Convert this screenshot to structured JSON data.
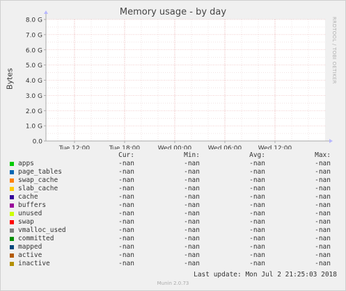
{
  "chart_data": {
    "type": "area",
    "title": "Memory usage - by day",
    "ylabel": "Bytes",
    "ylim": [
      0,
      8
    ],
    "yticks": [
      "0.0",
      "1.0 G",
      "2.0 G",
      "3.0 G",
      "4.0 G",
      "5.0 G",
      "6.0 G",
      "7.0 G",
      "8.0 G"
    ],
    "xticks": [
      "Tue 12:00",
      "Tue 18:00",
      "Wed 00:00",
      "Wed 06:00",
      "Wed 12:00"
    ],
    "grid": true,
    "series": [
      {
        "name": "apps",
        "color": "#00cc00",
        "values": []
      },
      {
        "name": "page_tables",
        "color": "#0066b3",
        "values": []
      },
      {
        "name": "swap_cache",
        "color": "#ff8000",
        "values": []
      },
      {
        "name": "slab_cache",
        "color": "#ffcc00",
        "values": []
      },
      {
        "name": "cache",
        "color": "#330099",
        "values": []
      },
      {
        "name": "buffers",
        "color": "#990099",
        "values": []
      },
      {
        "name": "unused",
        "color": "#ccff00",
        "values": []
      },
      {
        "name": "swap",
        "color": "#ff0000",
        "values": []
      },
      {
        "name": "vmalloc_used",
        "color": "#808080",
        "values": []
      },
      {
        "name": "committed",
        "color": "#008f00",
        "values": []
      },
      {
        "name": "mapped",
        "color": "#00487d",
        "values": []
      },
      {
        "name": "active",
        "color": "#b35a00",
        "values": []
      },
      {
        "name": "inactive",
        "color": "#b38f00",
        "values": []
      }
    ]
  },
  "legend": {
    "headers": {
      "cur": "Cur:",
      "min": "Min:",
      "avg": "Avg:",
      "max": "Max:"
    },
    "rows": [
      {
        "name": "apps",
        "cur": "-nan",
        "min": "-nan",
        "avg": "-nan",
        "max": "-nan"
      },
      {
        "name": "page_tables",
        "cur": "-nan",
        "min": "-nan",
        "avg": "-nan",
        "max": "-nan"
      },
      {
        "name": "swap_cache",
        "cur": "-nan",
        "min": "-nan",
        "avg": "-nan",
        "max": "-nan"
      },
      {
        "name": "slab_cache",
        "cur": "-nan",
        "min": "-nan",
        "avg": "-nan",
        "max": "-nan"
      },
      {
        "name": "cache",
        "cur": "-nan",
        "min": "-nan",
        "avg": "-nan",
        "max": "-nan"
      },
      {
        "name": "buffers",
        "cur": "-nan",
        "min": "-nan",
        "avg": "-nan",
        "max": "-nan"
      },
      {
        "name": "unused",
        "cur": "-nan",
        "min": "-nan",
        "avg": "-nan",
        "max": "-nan"
      },
      {
        "name": "swap",
        "cur": "-nan",
        "min": "-nan",
        "avg": "-nan",
        "max": "-nan"
      },
      {
        "name": "vmalloc_used",
        "cur": "-nan",
        "min": "-nan",
        "avg": "-nan",
        "max": "-nan"
      },
      {
        "name": "committed",
        "cur": "-nan",
        "min": "-nan",
        "avg": "-nan",
        "max": "-nan"
      },
      {
        "name": "mapped",
        "cur": "-nan",
        "min": "-nan",
        "avg": "-nan",
        "max": "-nan"
      },
      {
        "name": "active",
        "cur": "-nan",
        "min": "-nan",
        "avg": "-nan",
        "max": "-nan"
      },
      {
        "name": "inactive",
        "cur": "-nan",
        "min": "-nan",
        "avg": "-nan",
        "max": "-nan"
      }
    ]
  },
  "footer": {
    "last_update": "Last update: Mon Jul  2 21:25:03 2018",
    "version": "Munin 2.0.73"
  },
  "watermark": "RRDTOOL / TOBI OETIKER"
}
